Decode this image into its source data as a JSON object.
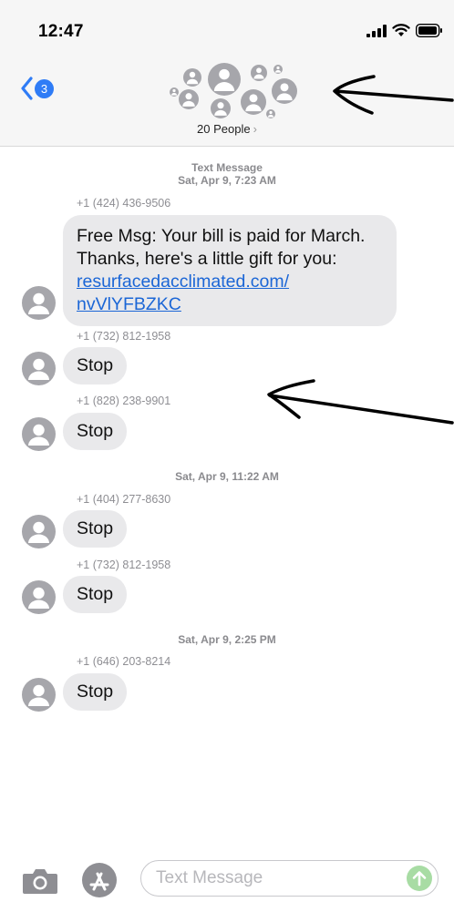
{
  "status": {
    "time": "12:47"
  },
  "nav": {
    "back_count": "3",
    "people_label": "20 People"
  },
  "timestamps": {
    "t1_title": "Text Message",
    "t1_date": "Sat, Apr 9, 7:23 AM",
    "t2": "Sat, Apr 9, 11:22 AM",
    "t3": "Sat, Apr 9, 2:25 PM"
  },
  "messages": [
    {
      "sender": "+1 (424) 436-9506",
      "text": "Free Msg: Your bill is paid for March. Thanks, here's a little gift for you:",
      "link": "resurfacedacclimated.com/ nvVlYFBZKC"
    },
    {
      "sender": "+1 (732) 812-1958",
      "text": "Stop"
    },
    {
      "sender": "+1 (828) 238-9901",
      "text": "Stop"
    },
    {
      "sender": "+1 (404) 277-8630",
      "text": "Stop"
    },
    {
      "sender": "+1 (732) 812-1958",
      "text": "Stop"
    },
    {
      "sender": "+1 (646) 203-8214",
      "text": "Stop"
    }
  ],
  "composer": {
    "placeholder": "Text Message"
  },
  "icons": {
    "back": "chevron-left-icon",
    "camera": "camera-icon",
    "app_store": "app-store-icon",
    "send": "send-arrow-icon",
    "avatar": "person-avatar-icon"
  },
  "colors": {
    "accent": "#2f7cf6",
    "bubble": "#e9e9eb",
    "link": "#1b66d6",
    "send": "#a8dca4"
  }
}
